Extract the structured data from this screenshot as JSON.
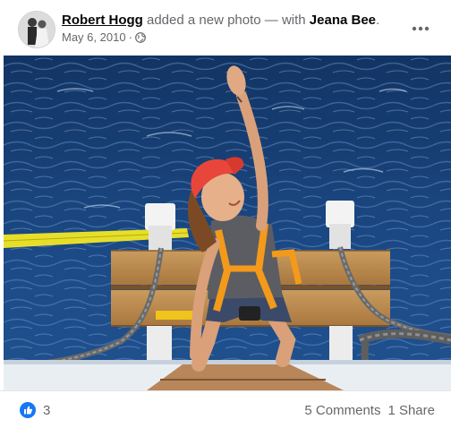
{
  "post": {
    "author": "Robert Hogg",
    "action": "added a new photo — with",
    "tagged": "Jeana Bee",
    "tagged_suffix": ".",
    "date": "May 6, 2010",
    "separator": "·",
    "privacy_icon": "globe-icon",
    "more_icon": "more-options-icon"
  },
  "photo": {
    "subject": "woman-climbing-rope-ladder"
  },
  "footer": {
    "reaction_icon": "like-icon",
    "reaction_count": "3",
    "comments": "5 Comments",
    "shares": "1 Share"
  },
  "colors": {
    "like_blue": "#1877f2",
    "secondary_text": "#65676b",
    "sea": "#163a6e",
    "harness": "#f39a1a",
    "cap": "#e8463a",
    "rope_yellow": "#e6df2a"
  }
}
